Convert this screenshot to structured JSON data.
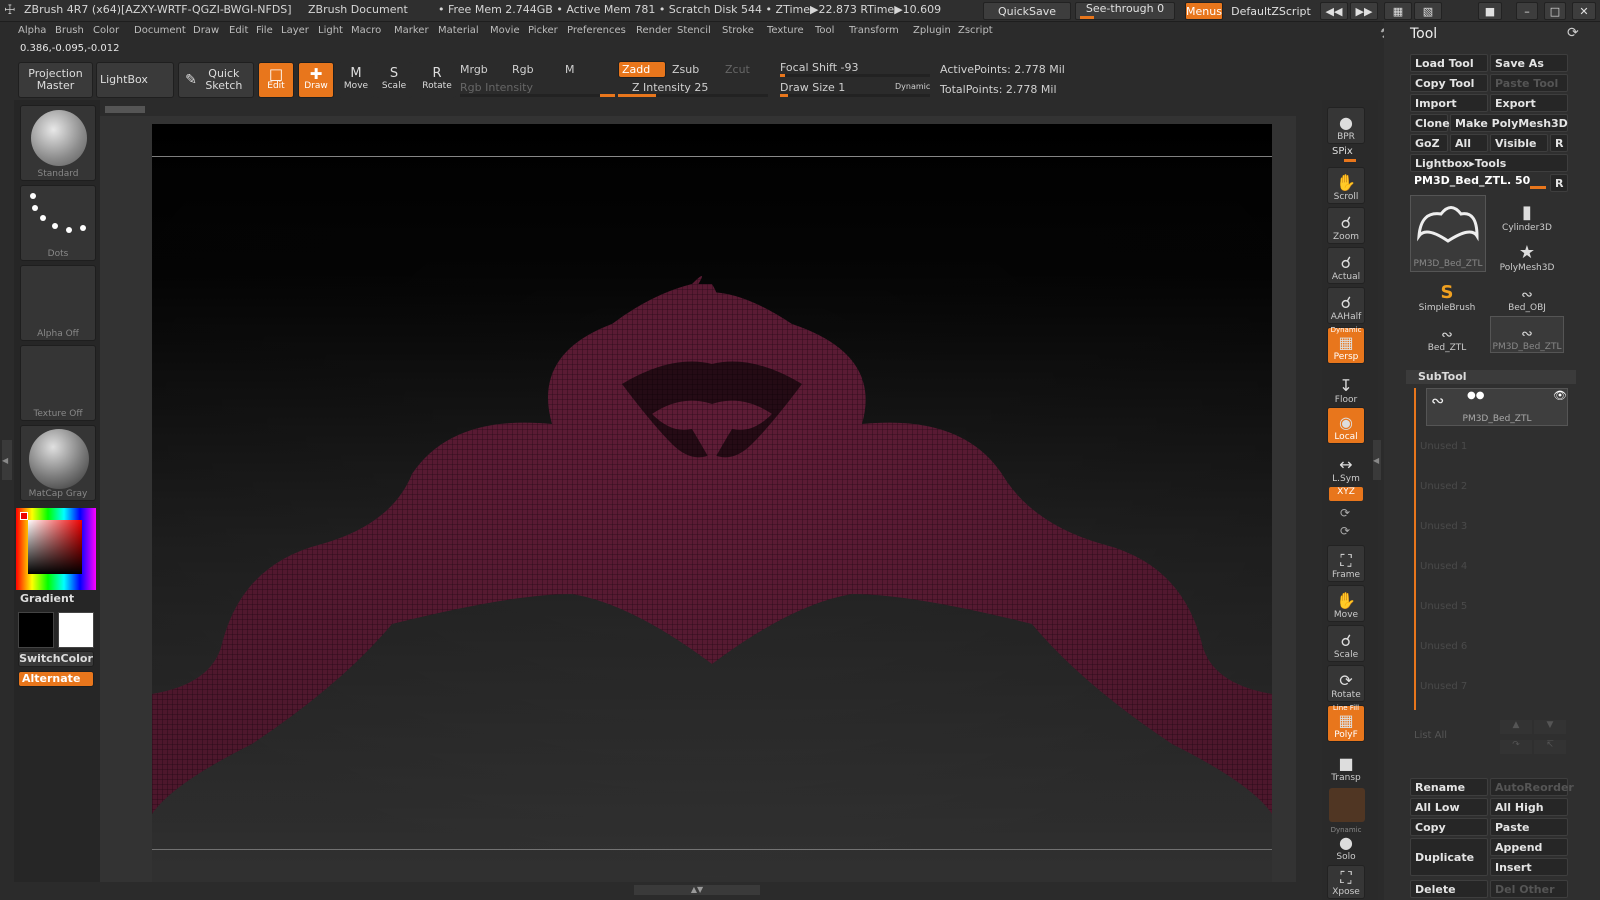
{
  "app": {
    "logo_icon": "zbrush-man-icon",
    "title": "ZBrush 4R7 (x64)[AZXY-WRTF-QGZI-BWGI-NFDS]",
    "document": "ZBrush Document",
    "stats": "• Free Mem 2.744GB • Active Mem 781 • Scratch Disk 544 • ZTime▶22.873 RTime▶10.609",
    "quicksave": "QuickSave",
    "seethrough": "See-through  0",
    "seethrough_value": 0,
    "menus": "Menus",
    "defaultzscript": "DefaultZScript"
  },
  "menus": [
    "Alpha",
    "Brush",
    "Color",
    "Document",
    "Draw",
    "Edit",
    "File",
    "Layer",
    "Light",
    "Macro",
    "Marker",
    "Material",
    "Movie",
    "Picker",
    "Preferences",
    "Render",
    "Stencil",
    "Stroke",
    "Texture",
    "Tool",
    "Transform",
    "Zplugin",
    "Zscript"
  ],
  "coords": "0.386,-0.095,-0.012",
  "toolbar": {
    "projection_master": "Projection Master",
    "lightbox": "LightBox",
    "quick_sketch": "Quick Sketch",
    "edit": "Edit",
    "draw": "Draw",
    "move": "Move",
    "scale": "Scale",
    "rotate": "Rotate",
    "mrgb": "Mrgb",
    "rgb": "Rgb",
    "m": "M",
    "rgb_intensity": "Rgb Intensity",
    "zadd": "Zadd",
    "zsub": "Zsub",
    "zcut": "Zcut",
    "z_intensity": "Z Intensity 25",
    "z_intensity_value": 25,
    "focal_shift": "Focal Shift -93",
    "focal_shift_value": -93,
    "draw_size": "Draw Size 1",
    "draw_size_value": 1,
    "dynamic": "Dynamic",
    "active_points": "ActivePoints: 2.778  Mil",
    "total_points": "TotalPoints: 2.778  Mil"
  },
  "left": {
    "brush": "Standard",
    "stroke": "Dots",
    "alpha": "Alpha Off",
    "texture": "Texture Off",
    "material": "MatCap Gray",
    "gradient": "Gradient",
    "switchcolor": "SwitchColor",
    "alternate": "Alternate",
    "main_color": "#000000",
    "secondary_color": "#ffffff"
  },
  "right_shelf": [
    {
      "label": "BPR",
      "icon": "bpr-icon"
    },
    {
      "label": "SPix",
      "icon": "spix-icon"
    },
    {
      "label": "Scroll",
      "icon": "scroll-hand-icon"
    },
    {
      "label": "Zoom",
      "icon": "zoom-icon"
    },
    {
      "label": "Actual",
      "icon": "actual-icon"
    },
    {
      "label": "AAHalf",
      "icon": "aahalf-icon"
    },
    {
      "label": "Persp",
      "icon": "persp-icon",
      "sub": "Dynamic"
    },
    {
      "label": "Floor",
      "icon": "floor-icon"
    },
    {
      "label": "Local",
      "icon": "local-icon"
    },
    {
      "label": "L.Sym",
      "icon": "lsym-icon"
    },
    {
      "label": "XYZ",
      "icon": "xyz-icon"
    },
    {
      "label": "Frame",
      "icon": "frame-icon"
    },
    {
      "label": "Move",
      "icon": "move-hand-icon"
    },
    {
      "label": "Scale",
      "icon": "scale-icon"
    },
    {
      "label": "Rotate",
      "icon": "rotate-icon"
    },
    {
      "label": "PolyF",
      "icon": "polyf-icon",
      "sub": "Line Fill"
    },
    {
      "label": "Transp",
      "icon": "transp-icon"
    },
    {
      "label": "Solo",
      "icon": "solo-icon",
      "sub": "Dynamic"
    },
    {
      "label": "Xpose",
      "icon": "xpose-icon"
    }
  ],
  "tool": {
    "title": "Tool",
    "load_tool": "Load Tool",
    "save_as": "Save As",
    "copy_tool": "Copy Tool",
    "paste_tool": "Paste Tool",
    "import": "Import",
    "export": "Export",
    "clone": "Clone",
    "make_polymesh": "Make PolyMesh3D",
    "goz": "GoZ",
    "all": "All",
    "visible": "Visible",
    "r": "R",
    "lightbox_tools": "Lightbox▸Tools",
    "current_tool": "PM3D_Bed_ZTL. 50",
    "thumbs": [
      "PM3D_Bed_ZTL",
      "Cylinder3D",
      "PolyMesh3D",
      "SimpleBrush",
      "Bed_OBJ",
      "Bed_ZTL",
      "PM3D_Bed_ZTL"
    ]
  },
  "subtool": {
    "title": "SubTool",
    "active": "PM3D_Bed_ZTL",
    "unused": [
      "Unused 1",
      "Unused 2",
      "Unused 3",
      "Unused 4",
      "Unused 5",
      "Unused 6",
      "Unused 7"
    ],
    "list_all": "List All",
    "rename": "Rename",
    "autoreorder": "AutoReorder",
    "all_low": "All Low",
    "all_high": "All High",
    "copy": "Copy",
    "paste": "Paste",
    "duplicate": "Duplicate",
    "append": "Append",
    "insert": "Insert",
    "delete": "Delete",
    "del_other": "Del Other"
  }
}
